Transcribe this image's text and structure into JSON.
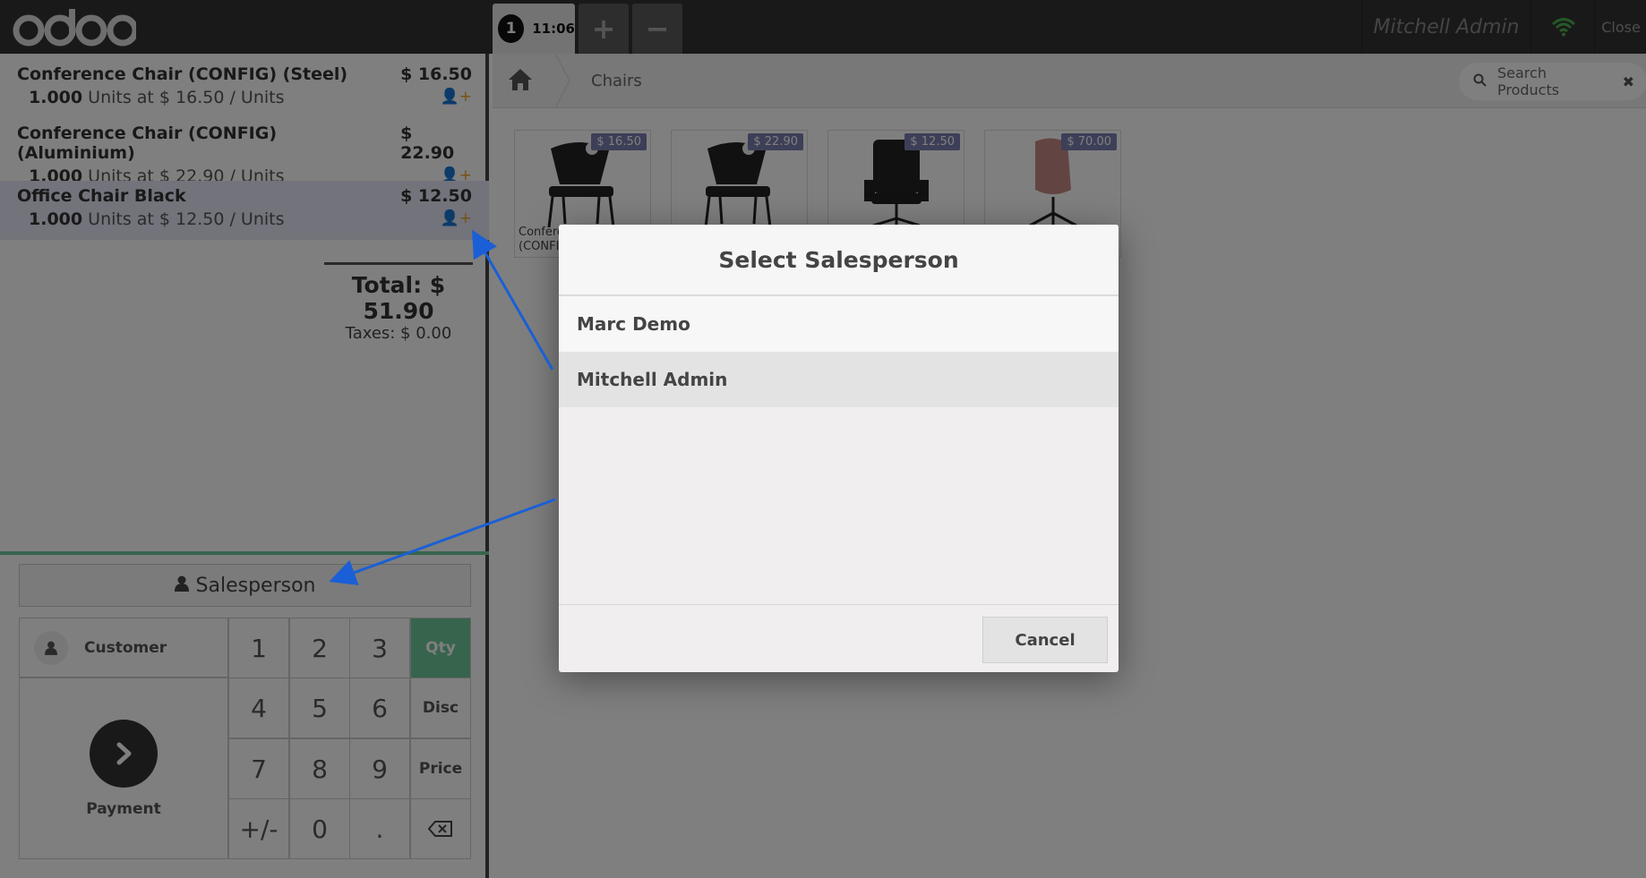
{
  "header": {
    "logo_alt": "odoo",
    "order_tab": {
      "number": "1",
      "time": "11:06"
    },
    "add_order": "+",
    "remove_order": "−",
    "user": "Mitchell Admin",
    "close": "Close"
  },
  "orderlines": [
    {
      "name": "Conference Chair (CONFIG) (Steel)",
      "price": "$ 16.50",
      "qty": "1.000",
      "unit_info": "Units at $ 16.50 / Units"
    },
    {
      "name": "Conference Chair (CONFIG) (Aluminium)",
      "price": "$ 22.90",
      "qty": "1.000",
      "unit_info": "Units at $ 22.90 / Units"
    },
    {
      "name": "Office Chair Black",
      "price": "$ 12.50",
      "qty": "1.000",
      "unit_info": "Units at $ 12.50 / Units"
    }
  ],
  "summary": {
    "total": "Total: $ 51.90",
    "taxes": "Taxes: $ 0.00"
  },
  "controls": {
    "salesperson": "Salesperson",
    "customer": "Customer",
    "payment": "Payment",
    "keys": [
      "1",
      "2",
      "3",
      "Qty",
      "4",
      "5",
      "6",
      "Disc",
      "7",
      "8",
      "9",
      "Price",
      "+/-",
      "0",
      "."
    ]
  },
  "products_pane": {
    "breadcrumb": "Chairs",
    "search_placeholder": "Search Products",
    "products": [
      {
        "price": "$ 16.50",
        "name_line1": "Confere",
        "name_line2": "(CONFI"
      },
      {
        "price": "$ 22.90",
        "name_line1": "",
        "name_line2": ""
      },
      {
        "price": "$ 12.50",
        "name_line1": "",
        "name_line2": ""
      },
      {
        "price": "$ 70.00",
        "name_line1": "",
        "name_line2": ""
      }
    ]
  },
  "modal": {
    "title": "Select Salesperson",
    "options": [
      "Marc Demo",
      "Mitchell Admin"
    ],
    "cancel": "Cancel"
  },
  "colors": {
    "accent": "#6ec89b",
    "header": "#323232",
    "price_tag": "#7a7fb0",
    "annotation_arrow": "#1a5fd6"
  }
}
